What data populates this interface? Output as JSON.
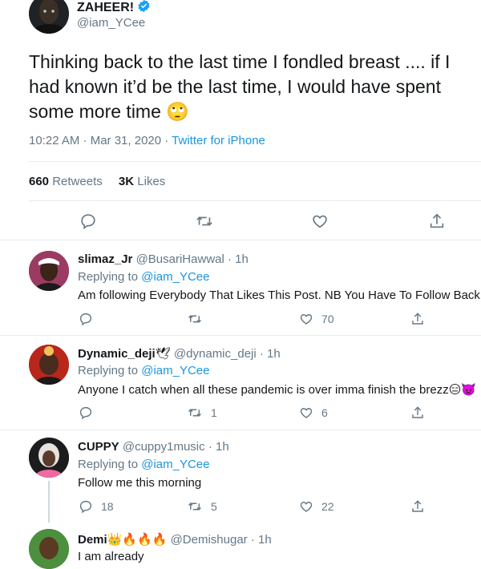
{
  "main_tweet": {
    "display_name": "ZAHEER!",
    "handle": "@iam_YCee",
    "text": "Thinking back to the last time I fondled breast .... if I had known it’d be the last time, I would have spent some more time",
    "emoji": "🙄",
    "time_date": "10:22 AM · Mar 31, 2020",
    "separator": " · ",
    "source": "Twitter for iPhone",
    "retweets_count": "660",
    "retweets_label": "Retweets",
    "likes_count": "3K",
    "likes_label": "Likes",
    "verified_icon": "verified-badge-icon"
  },
  "replies": [
    {
      "display_name": "slimaz_Jr",
      "handle": "@BusariHawwal",
      "time": "· 1h",
      "replying_prefix": "Replying to",
      "replying_to": "@iam_YCee",
      "text": "Am following Everybody That Likes This Post. NB You Have To Follow Back",
      "reply_count": "",
      "retweet_count": "",
      "like_count": "70"
    },
    {
      "display_name": "Dynamic_deji",
      "name_emoji": "🕊",
      "handle": "@dynamic_deji",
      "time": "· 1h",
      "replying_prefix": "Replying to",
      "replying_to": "@iam_YCee",
      "text": "Anyone I catch when all these pandemic is over imma finish the brezz",
      "text_emojis": "😑👿",
      "reply_count": "",
      "retweet_count": "1",
      "like_count": "6"
    },
    {
      "display_name": "CUPPY",
      "handle": "@cuppy1music",
      "time": "· 1h",
      "replying_prefix": "Replying to",
      "replying_to": "@iam_YCee",
      "text": "Follow me this morning",
      "reply_count": "18",
      "retweet_count": "5",
      "like_count": "22"
    },
    {
      "display_name": "Demi",
      "name_emoji": "👑🔥🔥🔥",
      "handle": "@Demishugar",
      "time": "· 1h",
      "text": "I am already"
    }
  ],
  "colors": {
    "link": "#1b95e0",
    "muted": "#657786",
    "text": "#14171a",
    "divider": "#e6ecf0"
  }
}
